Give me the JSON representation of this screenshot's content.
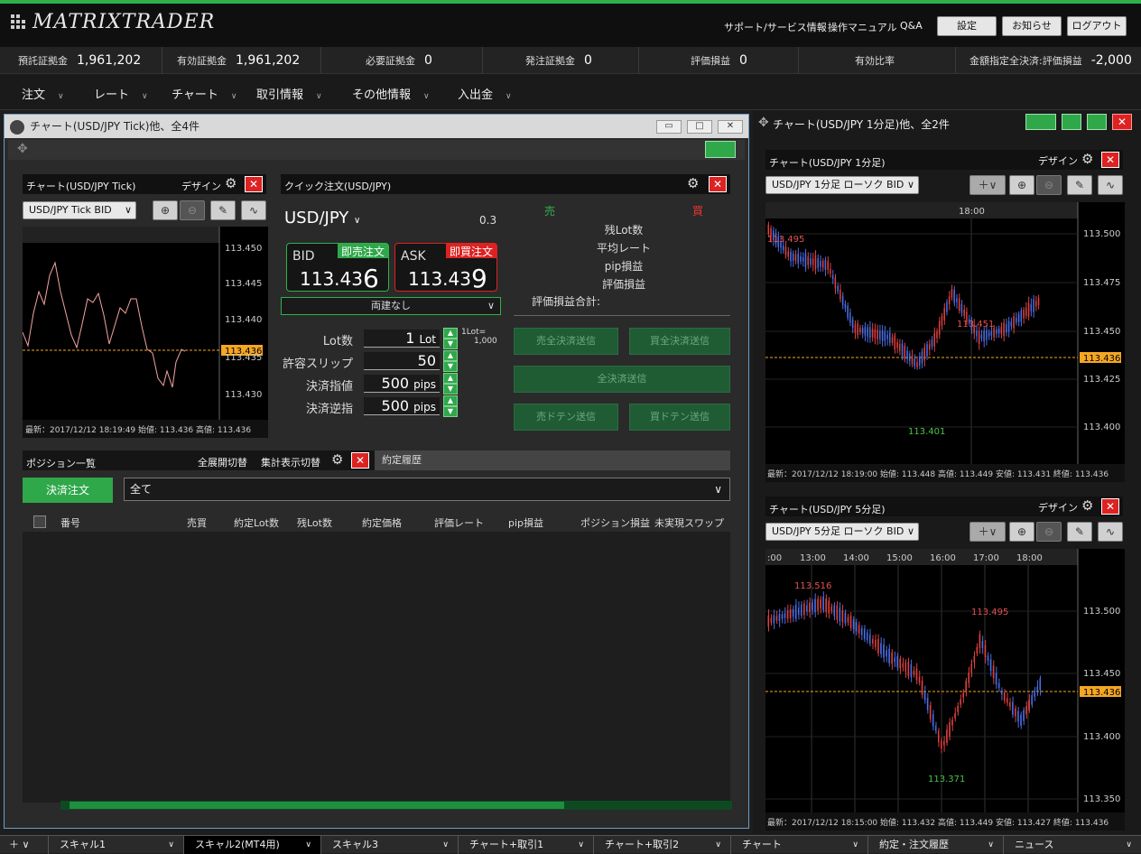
{
  "app": {
    "logo": "MATRIXTRADER",
    "links": [
      "サポート/サービス情報",
      "操作マニュアル",
      "Q&A"
    ],
    "buttons": [
      "設定",
      "お知らせ",
      "ログアウト"
    ]
  },
  "stats": [
    {
      "label": "預託証拠金",
      "value": "1,961,202"
    },
    {
      "label": "有効証拠金",
      "value": "1,961,202"
    },
    {
      "label": "必要証拠金",
      "value": "0"
    },
    {
      "label": "発注証拠金",
      "value": "0"
    },
    {
      "label": "評価損益",
      "value": "0"
    },
    {
      "label": "有効比率",
      "value": ""
    },
    {
      "label": "金額指定全決済:評価損益",
      "value": "-2,000"
    }
  ],
  "menu": [
    "注文",
    "レート",
    "チャート",
    "取引情報",
    "その他情報",
    "入出金"
  ],
  "left_window": {
    "title": "チャート(USD/JPY Tick)他、全4件",
    "tick_chart": {
      "title": "チャート(USD/JPY Tick)",
      "design": "デザイン",
      "select": "USD/JPY Tick BID",
      "yticks": [
        "113.450",
        "113.445",
        "113.440",
        "113.435",
        "113.430"
      ],
      "current": "113.436",
      "footer": "最新：2017/12/12 18:19:49  始値: 113.436  高値: 113.436"
    },
    "quick": {
      "title": "クイック注文(USD/JPY)",
      "pair": "USD/JPY",
      "spread": "0.3",
      "bid_label": "BID",
      "bid_btn": "即売注文",
      "bid_main": "113.43",
      "bid_sup": "6",
      "ask_label": "ASK",
      "ask_btn": "即買注文",
      "ask_main": "113.43",
      "ask_sup": "9",
      "ryodate": "両建なし",
      "lot_label": "Lot数",
      "lot_val": "1",
      "lot_unit": "Lot",
      "lot_note1": "1Lot=",
      "lot_note2": "1,000",
      "slip_label": "許容スリップ",
      "slip_val": "50",
      "limit_label": "決済指値",
      "limit_val": "500",
      "limit_unit": "pips",
      "stop_label": "決済逆指",
      "stop_val": "500",
      "stop_unit": "pips",
      "sell": "売",
      "buy": "買",
      "info": [
        "残Lot数",
        "平均レート",
        "pip損益",
        "評価損益"
      ],
      "total": "評価損益合計:",
      "btns": [
        "売全決済送信",
        "買全決済送信",
        "全決済送信",
        "売ドテン送信",
        "買ドテン送信"
      ]
    },
    "positions": {
      "title": "ポジション一覧",
      "expand": "全展開切替",
      "agg": "集計表示切替",
      "tab2": "約定履歴",
      "settle_btn": "決済注文",
      "filter": "全て",
      "cols": [
        "番号",
        "売買",
        "約定Lot数",
        "残Lot数",
        "約定価格",
        "評価レート",
        "pip損益",
        "ポジション損益",
        "未実現スワップ"
      ]
    }
  },
  "right_window": {
    "title": "チャート(USD/JPY 1分足)他、全2件",
    "c1": {
      "title": "チャート(USD/JPY 1分足)",
      "design": "デザイン",
      "select": "USD/JPY 1分足 ローソク BID",
      "time": "18:00",
      "yticks": [
        "113.500",
        "113.475",
        "113.450",
        "113.425",
        "113.400"
      ],
      "current": "113.436",
      "hi": "113.495",
      "mid": "113.451",
      "lo": "113.401",
      "footer": "最新：2017/12/12 18:19:00  始値: 113.448  高値: 113.449  安値: 113.431  終値: 113.436"
    },
    "c2": {
      "title": "チャート(USD/JPY 5分足)",
      "design": "デザイン",
      "select": "USD/JPY 5分足 ローソク BID",
      "times": [
        ":00",
        "13:00",
        "14:00",
        "15:00",
        "16:00",
        "17:00",
        "18:00"
      ],
      "yticks": [
        "113.500",
        "113.450",
        "113.400",
        "113.350"
      ],
      "current": "113.436",
      "hi": "113.516",
      "mid": "113.495",
      "lo": "113.371",
      "footer": "最新：2017/12/12 18:15:00  始値: 113.432  高値: 113.449  安値: 113.427  終値: 113.436"
    }
  },
  "tabs": [
    "スキャル1",
    "スキャル2(MT4用)",
    "スキャル3",
    "チャート+取引1",
    "チャート+取引2",
    "チャート",
    "約定・注文履歴",
    "ニュース"
  ],
  "colors": {
    "green": "#2fb14a",
    "red": "#d22",
    "candle_up": "#e04040",
    "candle_down": "#4a6fe8",
    "current_line": "#f5a623"
  }
}
